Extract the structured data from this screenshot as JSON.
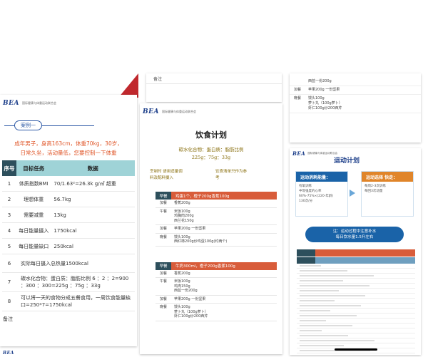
{
  "logo": "BEA",
  "left": {
    "header_text": "国际健康与体重运动联合会",
    "case_label": "案例一",
    "intro": [
      "成年男子，身高163cm，体重70kg，30岁，",
      "日常久坐，活动量低，您要控制一下体重"
    ],
    "headers": [
      "序号",
      "目标任务",
      "数据"
    ],
    "rows": [
      {
        "n": "1",
        "task": "体质指数BMI",
        "val": "70/1.63²=26.3k g/㎡    超重"
      },
      {
        "n": "2",
        "task": "理想体重",
        "val": "56.7kg"
      },
      {
        "n": "3",
        "task": "需要减重",
        "val": "13kg"
      },
      {
        "n": "4",
        "task": "每日能量摄入",
        "val": "1750kcal"
      },
      {
        "n": "5",
        "task": "每日能量缺口",
        "val": "250kcal"
      },
      {
        "n": "6",
        "task": "实际每日摄入总热量1500kcal",
        "val": ""
      },
      {
        "n": "7",
        "task": "碳水化合物：蛋白质：脂肪比例 6 ：2 ：2=900 ：300 ：300=225g ：75g ：33g",
        "val": ""
      },
      {
        "n": "8",
        "task": "可以将一天的食物分成五餐食用，一周饮食能量缺口=250*7=1750kcal",
        "val": ""
      }
    ],
    "note": "备注"
  },
  "mid_strip": {
    "note": "备注"
  },
  "mid": {
    "header_text": "国际健康与体重运动联合会",
    "title": "饮食计划",
    "summary": [
      "碳水化合物：蛋白质：脂肪比例",
      "225g：75g：33g"
    ],
    "tips": [
      [
        "烹制时 请用适量调",
        "料及配料摄入"
      ],
      [
        "饮食清单只作为参",
        "考"
      ]
    ],
    "meal1": {
      "name": "早餐",
      "items": "鸡蛋1个，橙子200g香蕉100g",
      "rows": [
        {
          "name": "加餐",
          "items": [
            "香蕉200g"
          ]
        },
        {
          "name": "午餐",
          "items": [
            "米饭100g",
            "鸡胸肉200g",
            "西兰花150g"
          ]
        },
        {
          "name": "加餐",
          "items": [
            "苹果200g  一份坚果"
          ]
        },
        {
          "name": "晚餐",
          "items": [
            "馒头100g",
            "西红柿200g炒鸡蛋100g(约两个)"
          ]
        }
      ]
    },
    "meal2": {
      "name": "早餐",
      "items": "牛奶300ml，橙子200g香蕉100g",
      "rows": [
        {
          "name": "加餐",
          "items": [
            "香蕉200g"
          ]
        },
        {
          "name": "午餐",
          "items": [
            "米饭100g",
            "鸡肉150g",
            "西蓝一份200g"
          ]
        },
        {
          "name": "加餐",
          "items": [
            "苹果200g  一份坚果"
          ]
        },
        {
          "name": "晚餐",
          "items": [
            "馒头100g",
            "萝卜丸（100g萝卜）",
            "虾仁100g炒200西芹"
          ]
        }
      ]
    }
  },
  "right_top": {
    "rows": [
      {
        "name": "",
        "items": [
          "西蓝一份200g"
        ]
      },
      {
        "name": "加餐",
        "items": [
          "苹果200g  一份坚果"
        ]
      },
      {
        "name": "晚餐",
        "items": [
          "馒头100g",
          "萝卜丸（100g萝卜）",
          "虾仁100g炒200西芹"
        ]
      }
    ]
  },
  "right_bottom": {
    "header_text": "国际健康与体重运动联合会",
    "title": "运动计划",
    "mode1": {
      "title": "运动消耗能量：",
      "items": [
        "有氧训练",
        "中等强度的心率",
        "60%-75%×(220-年龄)",
        "130次/分"
      ]
    },
    "mode2": {
      "title": "运动选择 快走：",
      "items": [
        "每周2-3次训练",
        "每回3次动量"
      ]
    },
    "pill": [
      "注：运动过程中注意补水",
      "每日饮水量1.5升左右"
    ]
  },
  "colors": {
    "teal": "#9fd3d7",
    "dark": "#2d4f5c",
    "orange": "#d85c3a",
    "blue": "#1d3f8a",
    "red": "#c0282d"
  }
}
